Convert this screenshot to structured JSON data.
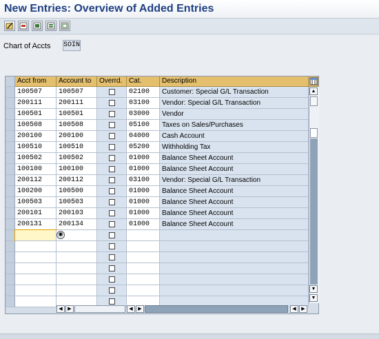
{
  "window": {
    "title": "New Entries: Overview of Added Entries"
  },
  "toolbar": {
    "buttons": [
      {
        "icon": "edit-pencil-icon"
      },
      {
        "icon": "delete-icon"
      },
      {
        "icon": "select-all-icon"
      },
      {
        "icon": "select-block-icon"
      },
      {
        "icon": "deselect-all-icon"
      }
    ]
  },
  "field": {
    "label": "Chart of Accts",
    "value": "SOIN"
  },
  "table": {
    "columns": [
      "Acct from",
      "Account to",
      "Overrd.",
      "Cat.",
      "Description"
    ],
    "rows": [
      {
        "from": "100507",
        "to": "100507",
        "cat": "02100",
        "desc": "Customer: Special G/L Transaction"
      },
      {
        "from": "200111",
        "to": "200111",
        "cat": "03100",
        "desc": "Vendor: Special G/L Transaction"
      },
      {
        "from": "100501",
        "to": "100501",
        "cat": "03000",
        "desc": "Vendor"
      },
      {
        "from": "100508",
        "to": "100508",
        "cat": "05100",
        "desc": "Taxes on Sales/Purchases"
      },
      {
        "from": "200100",
        "to": "200100",
        "cat": "04000",
        "desc": "Cash Account"
      },
      {
        "from": "100510",
        "to": "100510",
        "cat": "05200",
        "desc": "Withholding Tax"
      },
      {
        "from": "100502",
        "to": "100502",
        "cat": "01000",
        "desc": "Balance Sheet Account"
      },
      {
        "from": "100100",
        "to": "100100",
        "cat": "01000",
        "desc": "Balance Sheet Account"
      },
      {
        "from": "200112",
        "to": "200112",
        "cat": "03100",
        "desc": "Vendor: Special G/L Transaction"
      },
      {
        "from": "100200",
        "to": "100500",
        "cat": "01000",
        "desc": "Balance Sheet Account"
      },
      {
        "from": "100503",
        "to": "100503",
        "cat": "01000",
        "desc": "Balance Sheet Account"
      },
      {
        "from": "200101",
        "to": "200103",
        "cat": "01000",
        "desc": "Balance Sheet Account"
      },
      {
        "from": "200131",
        "to": "200134",
        "cat": "01000",
        "desc": "Balance Sheet Account"
      }
    ],
    "empty_rows": 7,
    "accent_colors": {
      "header": "#e3bf6e",
      "input_focus": "#fff7c8",
      "row_bg": "#d9e3ef"
    }
  }
}
